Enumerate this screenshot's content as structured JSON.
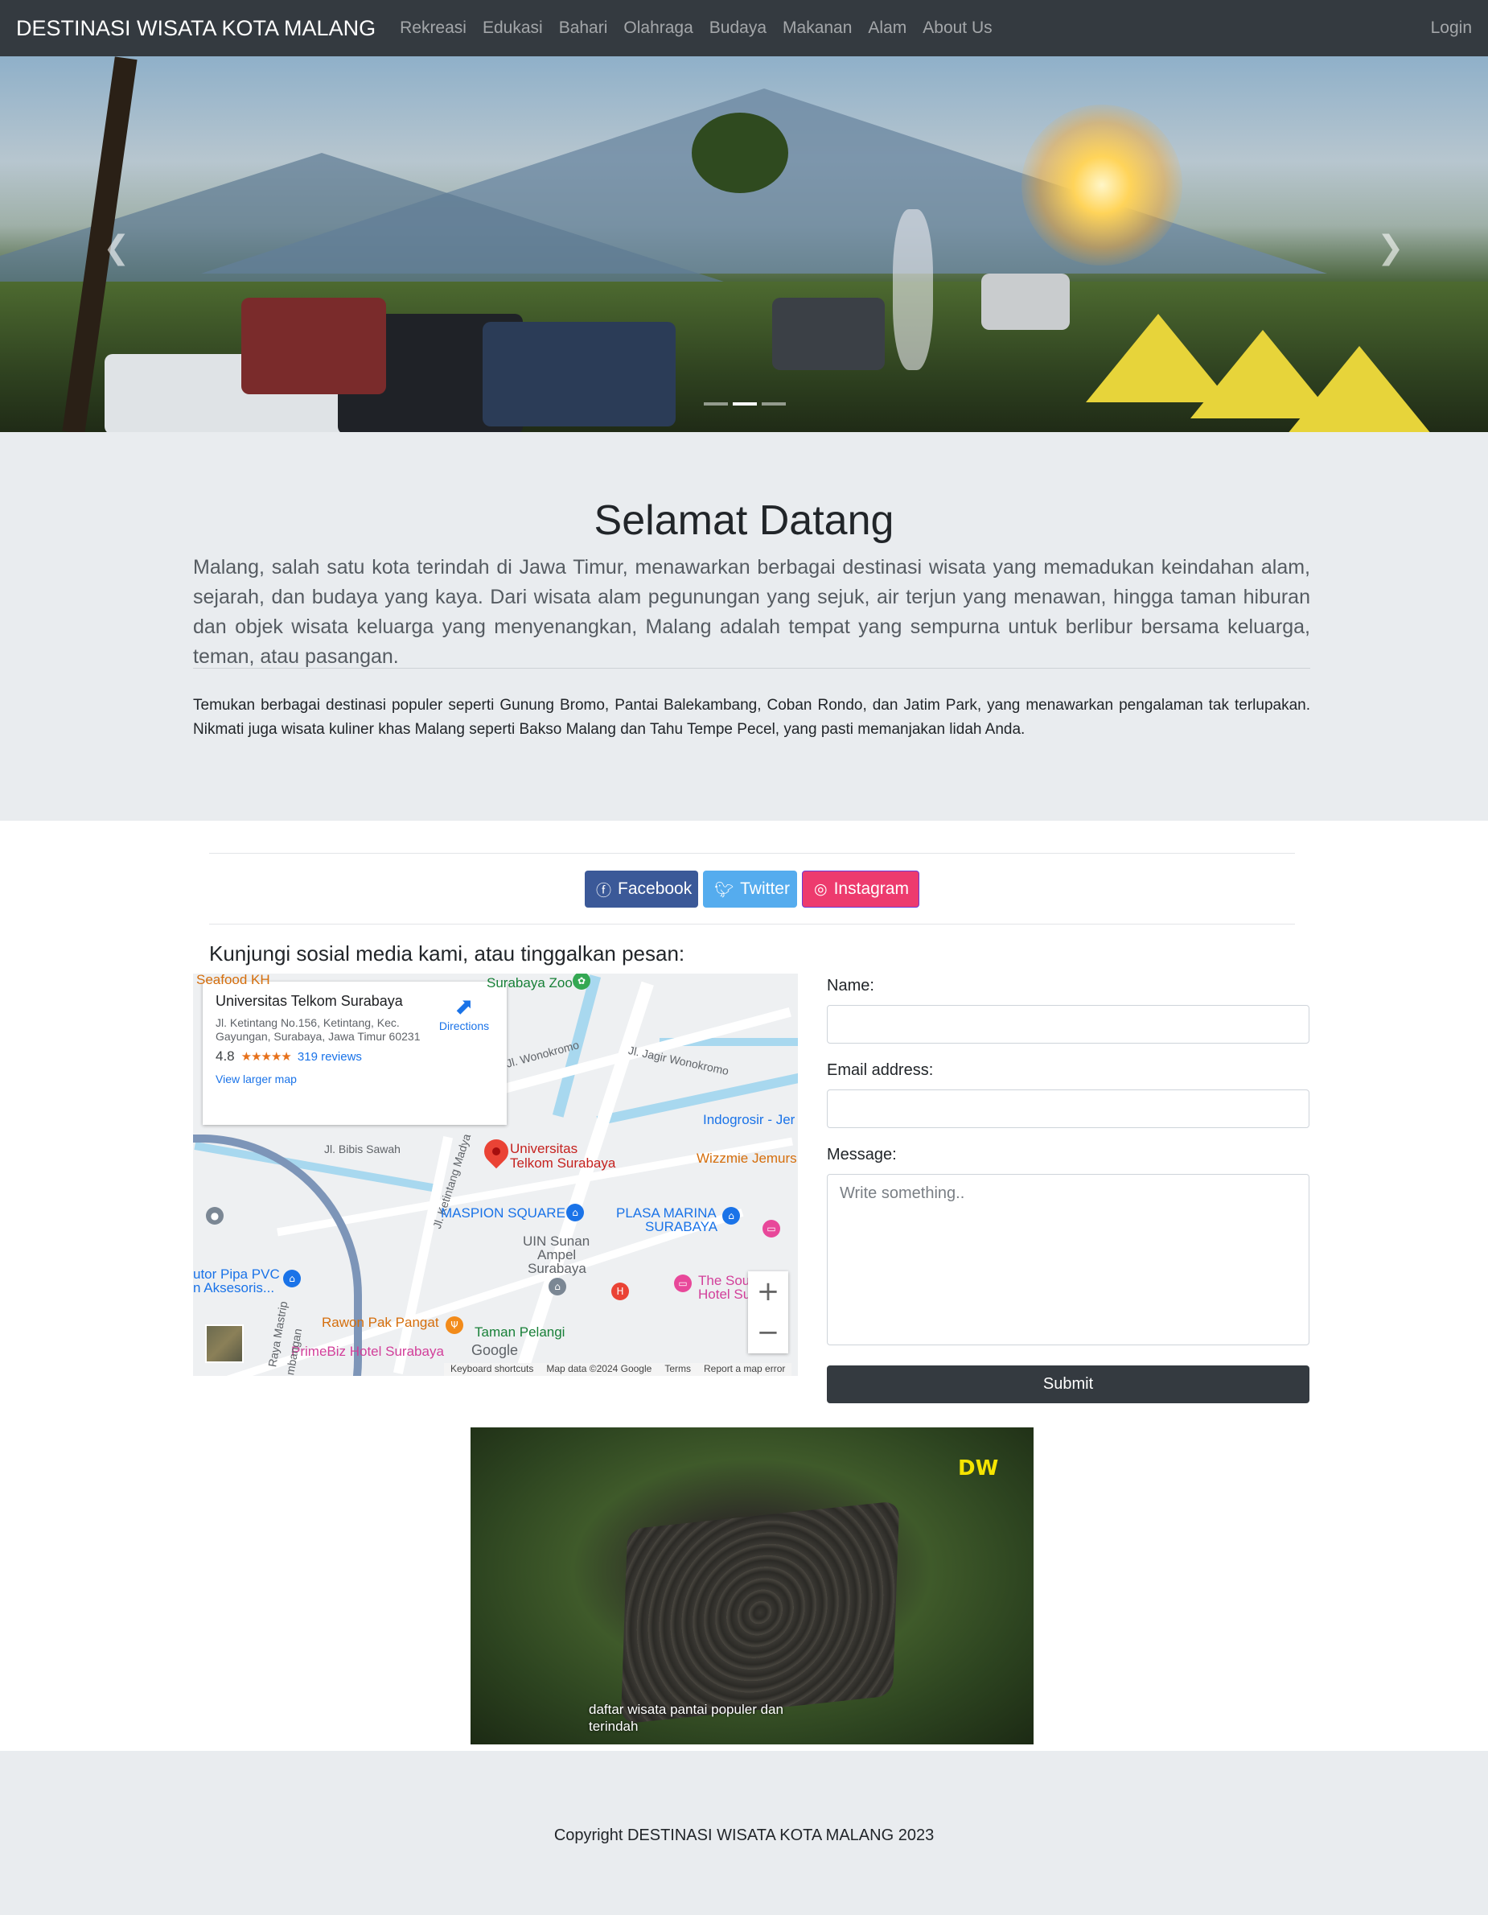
{
  "navbar": {
    "brand": "DESTINASI WISATA KOTA MALANG",
    "links": [
      "Rekreasi",
      "Edukasi",
      "Bahari",
      "Olahraga",
      "Budaya",
      "Makanan",
      "Alam",
      "About Us"
    ],
    "login": "Login"
  },
  "carousel": {
    "prev_icon": "chevron-left-icon",
    "next_icon": "chevron-right-icon",
    "slide_count": 3,
    "active_slide": 2
  },
  "jumbotron": {
    "title": "Selamat Datang",
    "lead": "Malang, salah satu kota terindah di Jawa Timur, menawarkan berbagai destinasi wisata yang memadukan keindahan alam, sejarah, dan budaya yang kaya. Dari wisata alam pegunungan yang sejuk, air terjun yang menawan, hingga taman hiburan dan objek wisata keluarga yang menyenangkan, Malang adalah tempat yang sempurna untuk berlibur bersama keluarga, teman, atau pasangan.",
    "paragraph": "Temukan berbagai destinasi populer seperti Gunung Bromo, Pantai Balekambang, Coban Rondo, dan Jatim Park, yang menawarkan pengalaman tak terlupakan. Nikmati juga wisata kuliner khas Malang seperti Bakso Malang dan Tahu Tempe Pecel, yang pasti memanjakan lidah Anda."
  },
  "social": {
    "facebook": "Facebook",
    "twitter": "Twitter",
    "instagram": "Instagram",
    "colors": {
      "facebook": "#3b5998",
      "twitter": "#55acee",
      "instagram": "#ed3b6e"
    }
  },
  "contact": {
    "heading": "Kunjungi sosial media kami, atau tinggalkan pesan:"
  },
  "map": {
    "place_name": "Universitas Telkom Surabaya",
    "address": "Jl. Ketintang No.156, Ketintang, Kec. Gayungan, Surabaya, Jawa Timur 60231",
    "rating": "4.8",
    "stars": "★★★★★",
    "reviews": "319 reviews",
    "directions": "Directions",
    "view_larger": "View larger map",
    "pin_label_1": "Universitas",
    "pin_label_2": "Telkom Surabaya",
    "labels": {
      "seafood": "Seafood KH",
      "zoo": "Surabaya Zoo",
      "wonokromo": "Jl. Wonokromo",
      "jagir": "Jl. Jagir Wonokromo",
      "indogrosir": "Indogrosir - Jer",
      "wizzmie": "Wizzmie Jemurs",
      "bibis": "Jl. Bibis Sawah",
      "ketintang": "Jl. Ketintang Madya",
      "maspion": "MASPION SQUARE",
      "plasa_marina_1": "PLASA MARINA",
      "plasa_marina_2": "SURABAYA",
      "uin_1": "UIN Sunan",
      "uin_2": "Ampel",
      "uin_3": "Surabaya",
      "pipa_1": "utor Pipa PVC",
      "pipa_2": "n Aksesoris...",
      "the_sou_1": "The Sou",
      "the_sou_2": "Hotel Su",
      "rawon": "Rawon Pak Pangat",
      "taman": "Taman Pelangi",
      "primebiz": "PrimeBiz Hotel Surabaya",
      "mastrip": "Raya Mastrip",
      "mbangan": "mbangan"
    },
    "footer": {
      "keyboard": "Keyboard shortcuts",
      "data": "Map data ©2024 Google",
      "terms": "Terms",
      "report": "Report a map error"
    },
    "google": "Google",
    "zoom_in": "+",
    "zoom_out": "−"
  },
  "form": {
    "name_label": "Name:",
    "email_label": "Email address:",
    "message_label": "Message:",
    "message_placeholder": "Write something..",
    "submit": "Submit"
  },
  "video": {
    "logo": "DW",
    "caption": "daftar wisata pantai populer dan terindah"
  },
  "footer": {
    "text": "Copyright DESTINASI WISATA KOTA MALANG 2023"
  }
}
